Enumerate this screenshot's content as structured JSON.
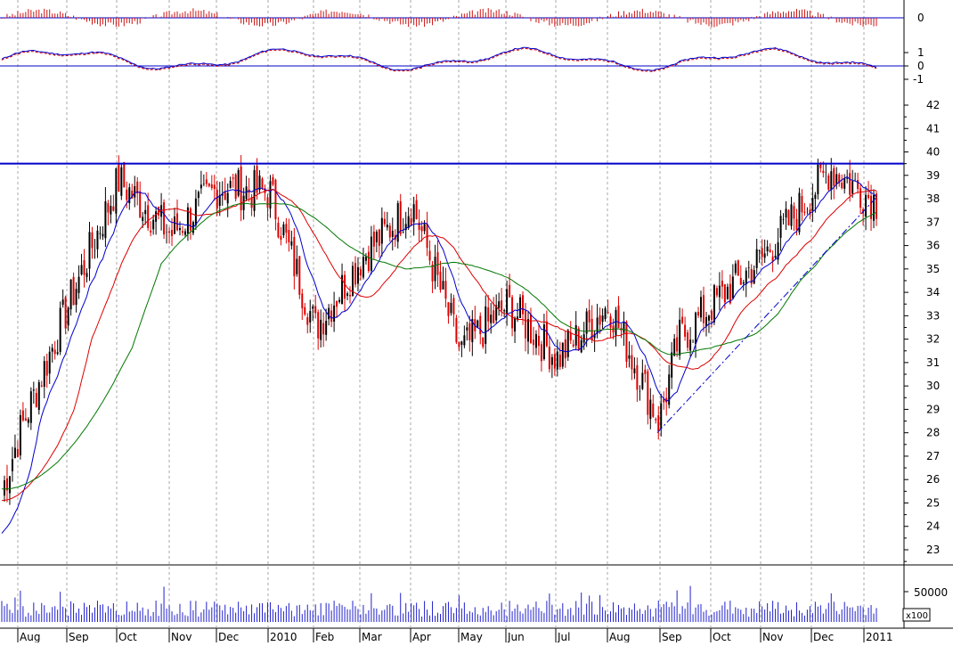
{
  "chart_data": [
    {
      "panel": "histogram",
      "type": "bar",
      "y_ticks": [
        "0"
      ],
      "zero_line": 0,
      "colors": {
        "bars": "#cc1111",
        "zero": "#0000cc"
      }
    },
    {
      "panel": "oscillator",
      "type": "line",
      "y_ticks": [
        "1",
        "0",
        "-1"
      ],
      "series": [
        {
          "style": "solid",
          "color": "#0000cc"
        },
        {
          "style": "dashed",
          "color": "#cc0000"
        }
      ]
    },
    {
      "panel": "price",
      "type": "candlestick",
      "ylim": [
        22.5,
        42.5
      ],
      "y_ticks": [
        "42",
        "41",
        "40",
        "39",
        "38",
        "37",
        "36",
        "35",
        "34",
        "33",
        "32",
        "31",
        "30",
        "29",
        "28",
        "27",
        "26",
        "25",
        "24",
        "23"
      ],
      "grid": true,
      "resistance_line": 39.5,
      "support_trendline": {
        "from": [
          "Sep 2010",
          28
        ],
        "to": [
          "Jan 2011",
          38.1
        ],
        "style": "dash-dot"
      },
      "price_path": [
        [
          "Jul 2009",
          25.5
        ],
        [
          "Aug 2009",
          28.0
        ],
        [
          "Sep 2009",
          33.5
        ],
        [
          "Oct 2009",
          38.8
        ],
        [
          "Nov 2009",
          36.5
        ],
        [
          "Dec 2009",
          38.5
        ],
        [
          "Jan 2010",
          38.3
        ],
        [
          "Feb 2010",
          32.5
        ],
        [
          "Mar 2010",
          35.5
        ],
        [
          "Apr 2010",
          37.8
        ],
        [
          "May 2010",
          31.5
        ],
        [
          "Jun 2010",
          33.5
        ],
        [
          "Jul 2010",
          31.2
        ],
        [
          "Aug 2010",
          33.5
        ],
        [
          "Aug 2010 late",
          28.5
        ],
        [
          "Sep 2010",
          32.0
        ],
        [
          "Oct 2010",
          33.5
        ],
        [
          "Nov 2010",
          35.5
        ],
        [
          "Dec 2010",
          39.3
        ],
        [
          "Jan 2011",
          37.8
        ]
      ],
      "moving_averages": [
        {
          "color": "#0000cc"
        },
        {
          "color": "#dd0000"
        },
        {
          "color": "#007700"
        }
      ],
      "colors": {
        "up": "#000000",
        "down": "#dd0000",
        "resistance": "#0000cc",
        "trend": "#0000cc"
      }
    },
    {
      "panel": "volume",
      "type": "bar",
      "y_ticks": [
        "50000"
      ],
      "unit_label": "x100",
      "colors": {
        "bars": "#2020cc"
      }
    }
  ],
  "x_axis": {
    "labels": [
      "Aug",
      "Sep",
      "Oct",
      "Nov",
      "Dec",
      "2010",
      "Feb",
      "Mar",
      "Apr",
      "May",
      "Jun",
      "Jul",
      "Aug",
      "Sep",
      "Oct",
      "Nov",
      "Dec",
      "2011"
    ]
  }
}
